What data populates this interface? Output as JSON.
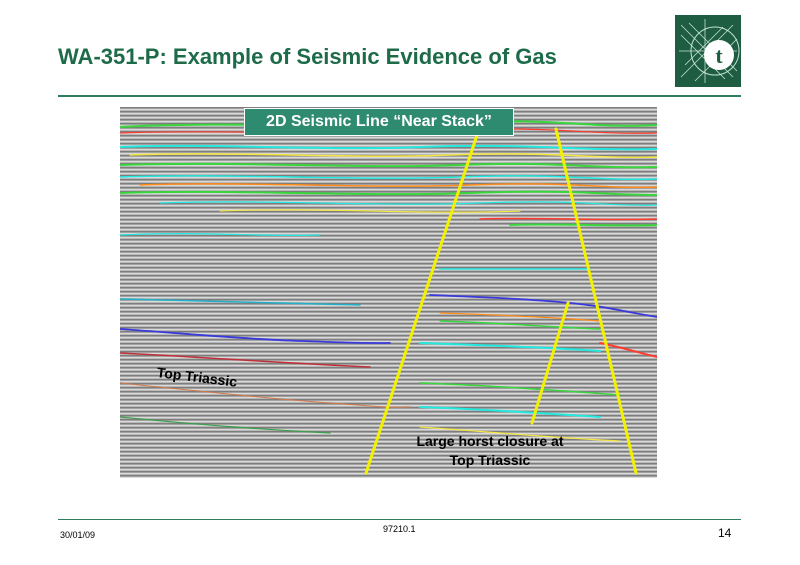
{
  "slide": {
    "title": "WA-351-P:  Example of Seismic Evidence of Gas",
    "banner": "2D Seismic Line “Near Stack”",
    "label_top_triassic": "Top Triassic",
    "label_horst_line1": "Large horst closure at",
    "label_horst_line2": "Top Triassic"
  },
  "footer": {
    "date": "30/01/09",
    "code": "97210.1",
    "page": "14"
  },
  "logo": {
    "letter": "t",
    "icon": "company-logo-icon"
  },
  "colors": {
    "title": "#1e6b4a",
    "banner_bg": "#2e8b6f",
    "fault_lines": "#f2f200",
    "rule": "#2e7d5b"
  }
}
